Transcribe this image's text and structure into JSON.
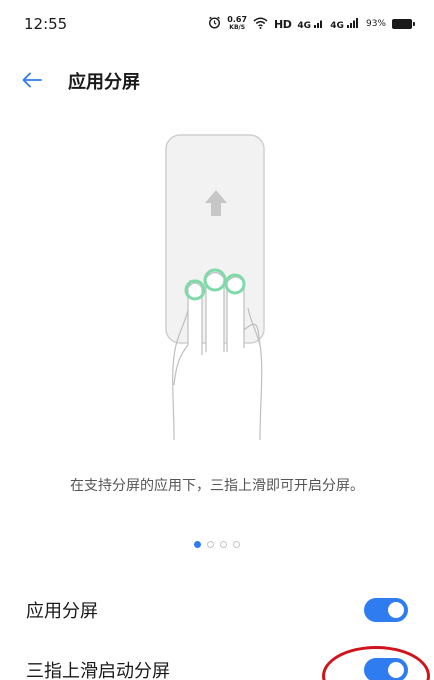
{
  "status_bar": {
    "time": "12:55",
    "speed_value": "0.67",
    "speed_unit": "KB/S",
    "hd": "HD",
    "network1": "4G",
    "network2": "4G",
    "battery_text": "93%"
  },
  "header": {
    "back_icon": "arrow-left-icon",
    "title": "应用分屏"
  },
  "illustration": {
    "icon": "three-finger-swipe-up-illustration",
    "accent_color": "#7fd9a8"
  },
  "description": "在支持分屏的应用下，三指上滑即可开启分屏。",
  "pager": {
    "count": 4,
    "active_index": 0
  },
  "settings": [
    {
      "label": "应用分屏",
      "enabled": true
    },
    {
      "label": "三指上滑启动分屏",
      "enabled": true
    }
  ],
  "colors": {
    "accent": "#2f7bf0",
    "annotation": "#d0141d"
  }
}
